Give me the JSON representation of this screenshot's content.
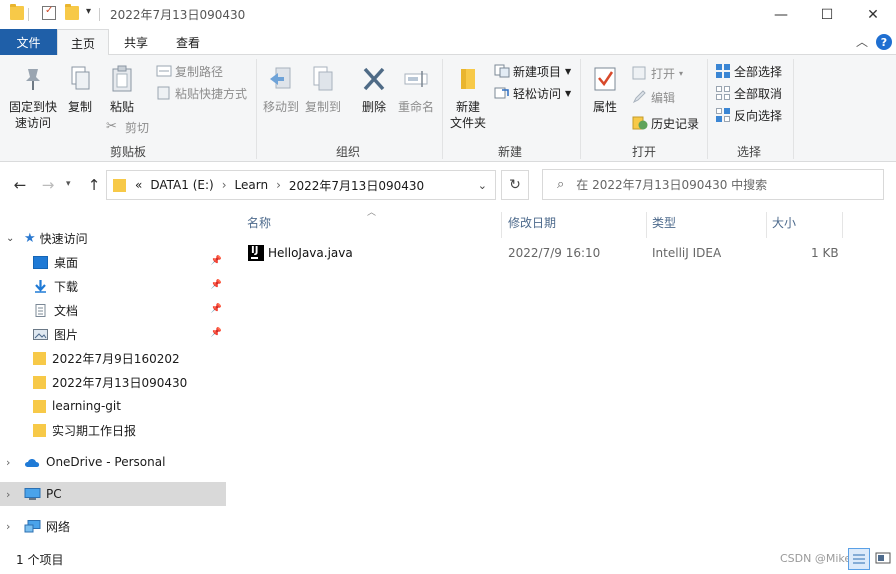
{
  "window": {
    "title": "2022年7月13日090430",
    "minimize_glyph": "—",
    "maximize_glyph": "☐",
    "close_glyph": "✕"
  },
  "tabs": {
    "file": "文件",
    "home": "主页",
    "share": "共享",
    "view": "查看"
  },
  "ribbon": {
    "clipboard": {
      "label": "剪贴板",
      "pin": "固定到快\n速访问",
      "copy": "复制",
      "paste": "粘贴",
      "copy_path": "复制路径",
      "paste_shortcut": "粘贴快捷方式",
      "cut": "剪切"
    },
    "organize": {
      "label": "组织",
      "move_to": "移动到",
      "copy_to": "复制到",
      "delete": "删除",
      "rename": "重命名"
    },
    "new": {
      "label": "新建",
      "new_folder": "新建\n文件夹",
      "new_item": "新建项目",
      "easy_access": "轻松访问"
    },
    "open": {
      "label": "打开",
      "properties": "属性",
      "open": "打开",
      "edit": "编辑",
      "history": "历史记录"
    },
    "select": {
      "label": "选择",
      "select_all": "全部选择",
      "select_none": "全部取消",
      "invert": "反向选择"
    }
  },
  "address": {
    "prefix": "«",
    "segments": [
      "DATA1 (E:)",
      "Learn",
      "2022年7月13日090430"
    ],
    "separator": "›",
    "search_placeholder": "在 2022年7月13日090430 中搜索"
  },
  "navpane": {
    "quick_access": "快速访问",
    "items": [
      "桌面",
      "下载",
      "文档",
      "图片",
      "2022年7月9日160202",
      "2022年7月13日090430",
      "learning-git",
      "实习期工作日报"
    ],
    "onedrive": "OneDrive - Personal",
    "pc": "PC",
    "network": "网络"
  },
  "columns": {
    "name": "名称",
    "modified": "修改日期",
    "type": "类型",
    "size": "大小"
  },
  "files": [
    {
      "name": "HelloJava.java",
      "modified": "2022/7/9 16:10",
      "type": "IntelliJ IDEA",
      "size": "1 KB",
      "icon": "intellij-java-icon"
    }
  ],
  "status": {
    "count": "1 个项目"
  },
  "watermark": "CSDN @Mike..."
}
